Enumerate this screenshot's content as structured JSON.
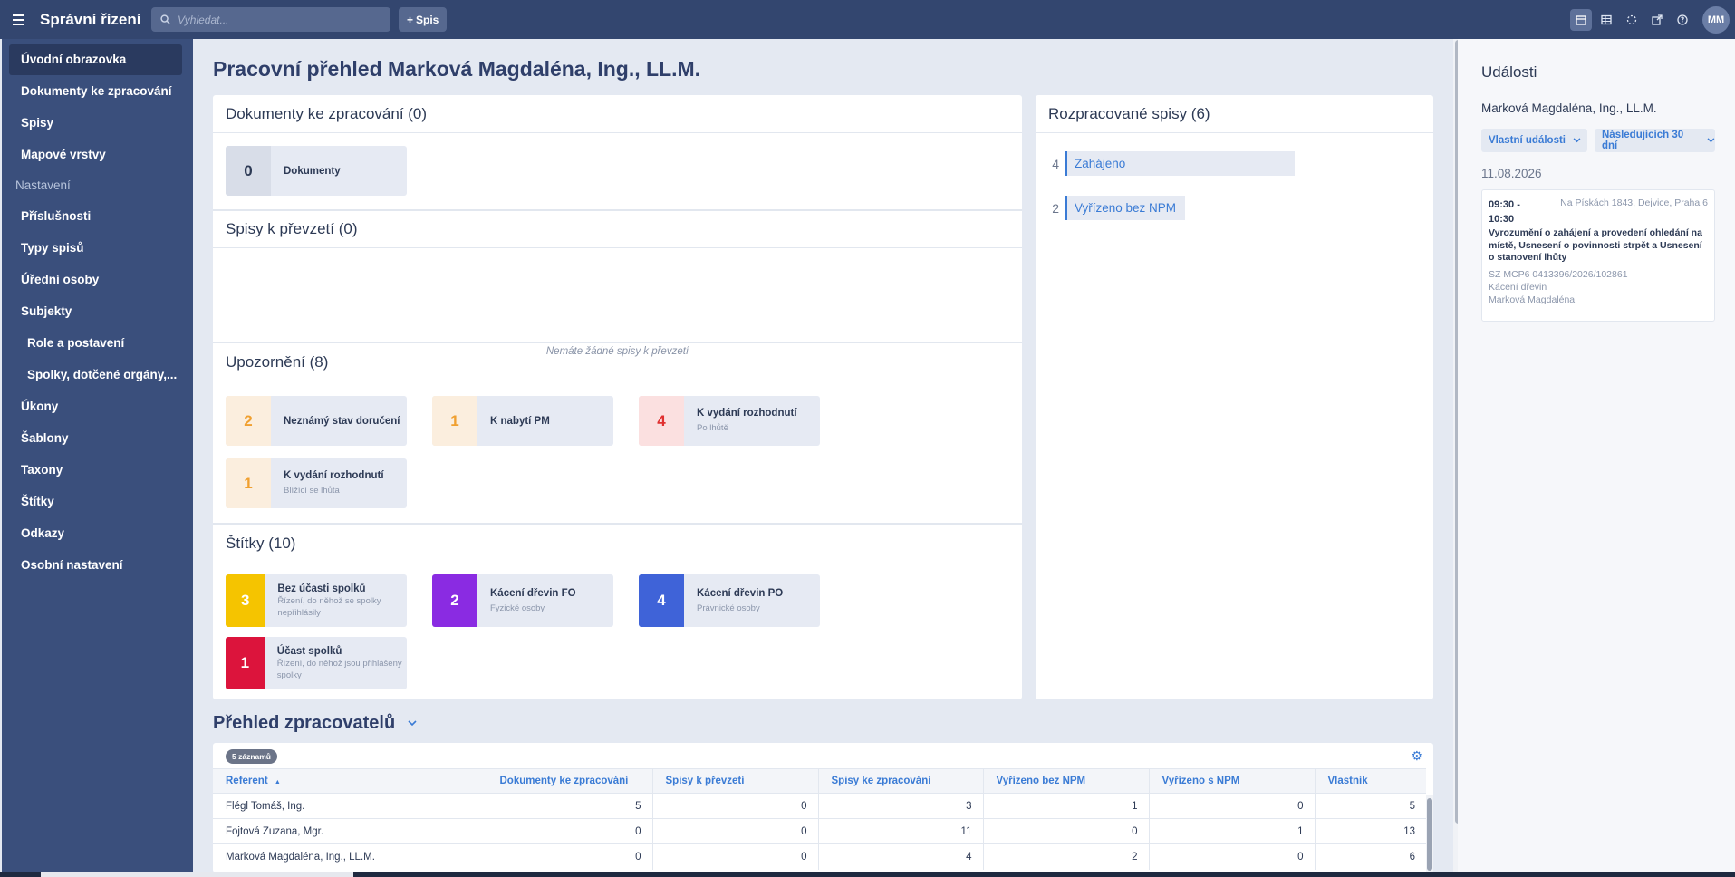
{
  "app": {
    "title": "Správní řízení"
  },
  "search": {
    "placeholder": "Vyhledat..."
  },
  "toolbar": {
    "add_label": "Spis",
    "avatar": "MM"
  },
  "sidebar": {
    "items": [
      {
        "label": "Úvodní obrazovka"
      },
      {
        "label": "Dokumenty ke zpracování"
      },
      {
        "label": "Spisy"
      },
      {
        "label": "Mapové vrstvy"
      }
    ],
    "settings_heading": "Nastavení",
    "settings_items": [
      {
        "label": "Příslušnosti"
      },
      {
        "label": "Typy spisů"
      },
      {
        "label": "Úřední osoby"
      },
      {
        "label": "Subjekty"
      },
      {
        "label": "Role a postavení"
      },
      {
        "label": "Spolky, dotčené orgány,..."
      },
      {
        "label": "Úkony"
      },
      {
        "label": "Šablony"
      },
      {
        "label": "Taxony"
      },
      {
        "label": "Štítky"
      },
      {
        "label": "Odkazy"
      },
      {
        "label": "Osobní nastavení"
      }
    ]
  },
  "main": {
    "page_title": "Pracovní přehled Marková Magdaléna, Ing., LL.M.",
    "dokumenty": {
      "title": "Dokumenty ke zpracování (0)",
      "tiles": [
        {
          "count": "0",
          "label": "Dokumenty"
        }
      ]
    },
    "prevzeti": {
      "title": "Spisy k převzetí (0)",
      "empty": "Nemáte žádné spisy k převzetí"
    },
    "upozorneni": {
      "title": "Upozornění (8)",
      "tiles": [
        {
          "count": "2",
          "label": "Neznámý stav doručení",
          "sub": ""
        },
        {
          "count": "1",
          "label": "K nabytí PM",
          "sub": ""
        },
        {
          "count": "4",
          "label": "K vydání rozhodnutí",
          "sub": "Po lhůtě"
        },
        {
          "count": "1",
          "label": "K vydání rozhodnutí",
          "sub": "Blížící se lhůta"
        }
      ]
    },
    "stitky": {
      "title": "Štítky (10)",
      "tiles": [
        {
          "count": "3",
          "label": "Bez účasti spolků",
          "sub": "Řízení, do něhož se spolky nepřihlásily",
          "color": "#f5c400"
        },
        {
          "count": "2",
          "label": "Kácení dřevin FO",
          "sub": "Fyzické osoby",
          "color": "#8a2be2"
        },
        {
          "count": "4",
          "label": "Kácení dřevin PO",
          "sub": "Právnické osoby",
          "color": "#3f63d8"
        },
        {
          "count": "1",
          "label": "Účast spolků",
          "sub": "Řízení, do něhož jsou přihlášeny spolky",
          "color": "#dc143c"
        }
      ]
    },
    "rozpracovane": {
      "title": "Rozpracované spisy (6)",
      "items": [
        {
          "count": "4",
          "label": "Zahájeno"
        },
        {
          "count": "2",
          "label": "Vyřízeno bez NPM"
        }
      ]
    },
    "prehled": {
      "title": "Přehled zpracovatelů",
      "badge": "5 záznamů",
      "columns": [
        "Referent",
        "Dokumenty ke zpracování",
        "Spisy k převzetí",
        "Spisy ke zpracování",
        "Vyřízeno bez NPM",
        "Vyřízeno s NPM",
        "Vlastník"
      ],
      "sort_indicator": "▲",
      "rows": [
        [
          "Flégl Tomáš, Ing.",
          "5",
          "0",
          "3",
          "1",
          "0",
          "5"
        ],
        [
          "Fojtová Zuzana, Mgr.",
          "0",
          "0",
          "11",
          "0",
          "1",
          "13"
        ],
        [
          "Marková Magdaléna, Ing., LL.M.",
          "0",
          "0",
          "4",
          "2",
          "0",
          "6"
        ]
      ]
    }
  },
  "events": {
    "title": "Události",
    "user": "Marková Magdaléna, Ing., LL.M.",
    "filter_type": "Vlastní události",
    "filter_range": "Následujících 30 dní",
    "date": "11.08.2026",
    "item": {
      "time": "09:30 - 10:30",
      "location": "Na Pískách 1843, Dejvice, Praha 6",
      "description": "Vyrozumění o zahájení a provedení ohledání na místě, Usnesení o povinnosti strpět a Usnesení o stanovení lhůty",
      "ref": "SZ MCP6 0413396/2026/102861",
      "type": "Kácení dřevin",
      "owner": "Marková Magdaléna"
    }
  },
  "colors": {
    "topbar": "#33466f",
    "sidebar": "#3a4f7c",
    "accent": "#3a7bd5",
    "warn_orange": "#f0a030",
    "warn_red": "#e03030"
  }
}
